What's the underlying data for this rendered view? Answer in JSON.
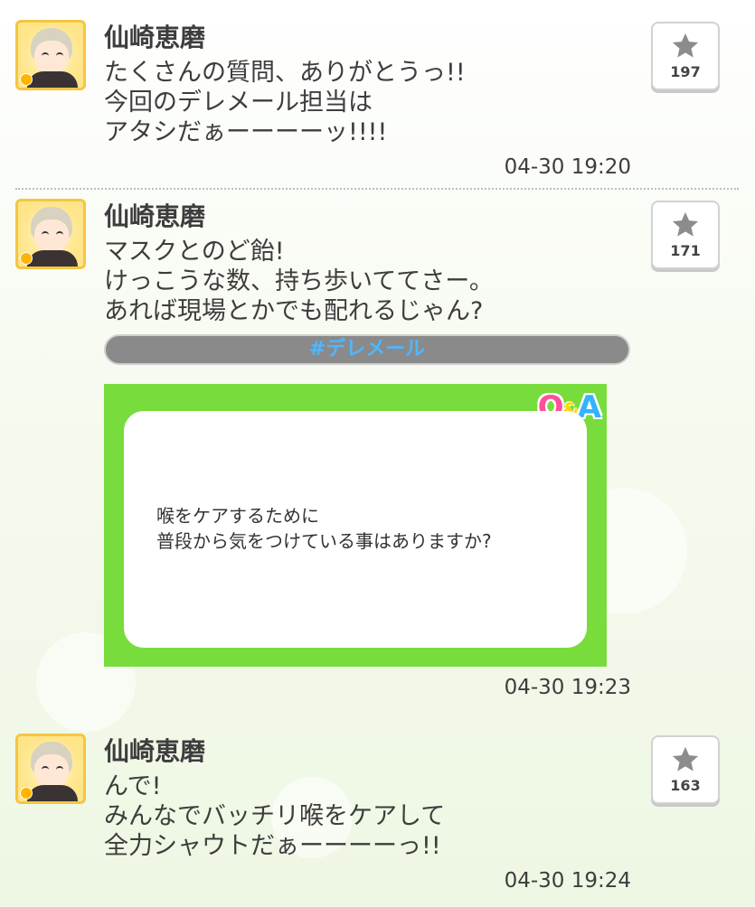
{
  "posts": [
    {
      "author": "仙崎恵磨",
      "message": "たくさんの質問、ありがとうっ!!\n今回のデレメール担当は\nアタシだぁーーーーッ!!!!",
      "star_count": "197",
      "timestamp": "04-30 19:20"
    },
    {
      "author": "仙崎恵磨",
      "message": "マスクとのど飴!\nけっこうな数、持ち歩いててさー。\nあれば現場とかでも配れるじゃん?",
      "star_count": "171",
      "hashtag": "#デレメール",
      "qa_question": "喉をケアするために\n普段から気をつけている事はありますか?",
      "timestamp": "04-30 19:23"
    },
    {
      "author": "仙崎恵磨",
      "message": "んで!\nみんなでバッチリ喉をケアして\n全力シャウトだぁーーーーっ!!",
      "star_count": "163",
      "timestamp": "04-30 19:24"
    }
  ],
  "qa_logo": {
    "q": "Q",
    "amp": "&",
    "a": "A"
  },
  "colors": {
    "qa_background": "#78dc3c",
    "hashtag_text": "#4fb6ff",
    "hashtag_bar": "#8a8a8a"
  }
}
